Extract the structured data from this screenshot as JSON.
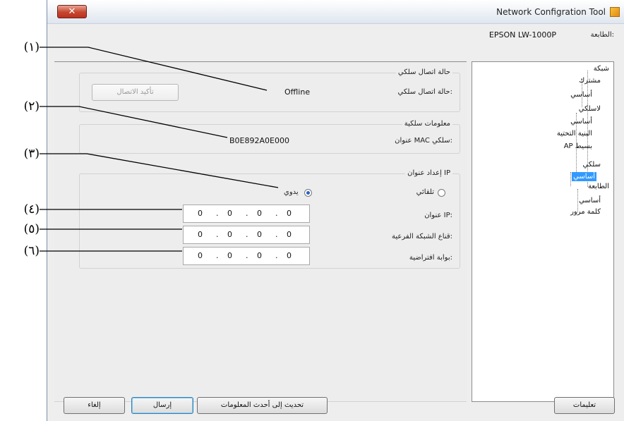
{
  "window": {
    "title": "Network Configration Tool",
    "close_glyph": "✕"
  },
  "printer": {
    "label": "الطابعة:",
    "name": "EPSON LW-1000P"
  },
  "callouts": [
    "(١)",
    "(٢)",
    "(٣)",
    "(٤)",
    "(٥)",
    "(٦)"
  ],
  "tree": {
    "items": [
      {
        "label": "شبكة"
      },
      {
        "label": "مشترك"
      },
      {
        "label": "أساسي"
      },
      {
        "label": "لاسلكي"
      },
      {
        "label": "أساسي"
      },
      {
        "label": "البنية التحتية"
      },
      {
        "label": "AP بسيط"
      },
      {
        "label": "سلكي"
      },
      {
        "label": "أساسي",
        "selected": true
      },
      {
        "label": "الطابعة"
      },
      {
        "label": "أساسي"
      },
      {
        "label": "كلمة مرور"
      }
    ]
  },
  "wired_status": {
    "title": "حالة اتصال سلكي",
    "label": "حالة اتصال سلكي:",
    "value": "Offline",
    "confirm_button": "تأكيد الاتصال"
  },
  "wired_info": {
    "title": "معلومات سلكية",
    "mac_label": "عنوان MAC سلكي:",
    "mac_value": "B0E892A0E000"
  },
  "ip_settings": {
    "title": "إعداد عنوان IP",
    "auto_label": "تلقائي",
    "manual_label": "يدوي",
    "selected": "manual",
    "ip_label": "عنوان IP:",
    "ip_value": [
      "0",
      "0",
      "0",
      "0"
    ],
    "subnet_label": "قناع الشبكة الفرعية:",
    "subnet_value": [
      "0",
      "0",
      "0",
      "0"
    ],
    "gateway_label": "بوابة افتراضية:",
    "gateway_value": [
      "0",
      "0",
      "0",
      "0"
    ]
  },
  "footer": {
    "help": "تعليمات",
    "refresh": "تحديث إلى أحدث المعلومات",
    "send": "إرسال",
    "cancel": "إلغاء"
  }
}
